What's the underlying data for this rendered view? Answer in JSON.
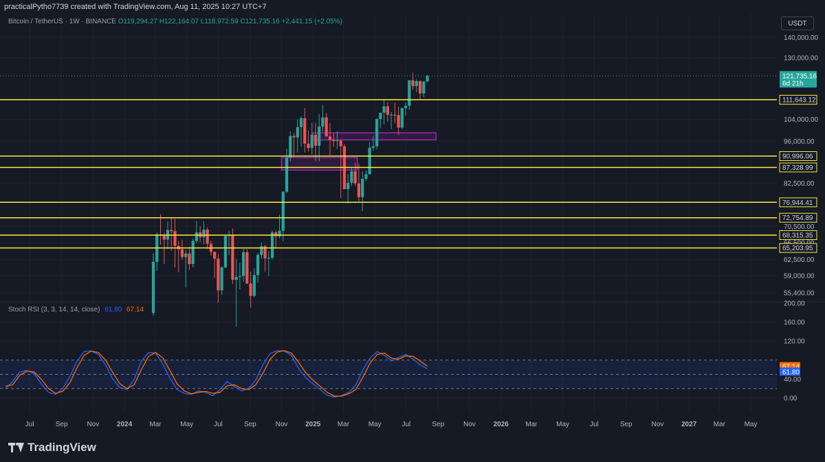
{
  "header": {
    "caption": "practicalPytho7739 created with TradingView.com, Aug 11, 2025 10:27 UTC+7"
  },
  "legend": {
    "symbol": "Bitcoin / TetherUS · 1W · BINANCE",
    "o": "O119,294.27",
    "h": "H122,164.07",
    "l": "L118,972.59",
    "c": "C121,735.16",
    "change": "+2,441.15 (+2.05%)"
  },
  "currency_button": "USDT",
  "stoch_legend": {
    "name": "Stoch RSI (3, 3, 14, 14, close)",
    "k_value": "61.80",
    "d_value": "67.14"
  },
  "footer": {
    "brand": "TradingView"
  },
  "colors": {
    "background": "#161a25",
    "bull": "#26a69a",
    "bear": "#ef5350",
    "level_line": "#ffeb3b",
    "zone": "#9c27b0",
    "k_line": "#2962ff",
    "d_line": "#ff6d00",
    "grid": "#1e2230",
    "axis_text": "#b2b5be"
  },
  "chart_data": [
    {
      "type": "candlestick",
      "title": "Bitcoin / TetherUS · 1W · BINANCE",
      "y_axis_ticks": [
        "140,000.00",
        "130,000.00",
        "104,000.00",
        "96,000.00",
        "82,500.00",
        "70,500.00",
        "66,500.00",
        "62,500.00",
        "59,000.00",
        "55,400.00"
      ],
      "y_scale": "log",
      "current_price": {
        "value": 121735.16,
        "label": "121,735.16",
        "countdown": "6d 21h"
      },
      "x_axis_ticks": [
        "Jul",
        "Sep",
        "Nov",
        "2024",
        "Mar",
        "May",
        "Jul",
        "Sep",
        "Nov",
        "2025",
        "Mar",
        "May",
        "Jul",
        "Sep",
        "Nov",
        "2026",
        "Mar",
        "May",
        "Jul",
        "Sep",
        "Nov",
        "2027",
        "Mar",
        "May"
      ],
      "horizontal_levels": [
        {
          "value": 111643.12,
          "label": "111,643.12"
        },
        {
          "value": 90996.06,
          "label": "90,996.06"
        },
        {
          "value": 87328.99,
          "label": "87,328.99"
        },
        {
          "value": 76944.41,
          "label": "76,944.41"
        },
        {
          "value": 72754.89,
          "label": "72,754.89"
        },
        {
          "value": 68315.35,
          "label": "68,315.35"
        },
        {
          "value": 65203.95,
          "label": "65,203.95"
        }
      ],
      "zones": [
        {
          "from": "2024-11",
          "to": "2025-03",
          "low": 86500,
          "high": 90500
        },
        {
          "from": "2025-01",
          "to": "2025-08",
          "low": 96500,
          "high": 99000
        }
      ],
      "candles": [
        {
          "date": "2024-02-26",
          "o": 51500,
          "h": 64000,
          "l": 51000,
          "c": 62000
        },
        {
          "date": "2024-03-04",
          "o": 62000,
          "h": 69000,
          "l": 60000,
          "c": 68500
        },
        {
          "date": "2024-03-11",
          "o": 68500,
          "h": 73700,
          "l": 66000,
          "c": 68400
        },
        {
          "date": "2024-03-18",
          "o": 68400,
          "h": 68900,
          "l": 61500,
          "c": 67200
        },
        {
          "date": "2024-03-25",
          "o": 67200,
          "h": 71800,
          "l": 65000,
          "c": 69600
        },
        {
          "date": "2024-04-01",
          "o": 69600,
          "h": 72800,
          "l": 64500,
          "c": 69300
        },
        {
          "date": "2024-04-08",
          "o": 69300,
          "h": 72500,
          "l": 60700,
          "c": 65700
        },
        {
          "date": "2024-04-15",
          "o": 65700,
          "h": 66900,
          "l": 59700,
          "c": 64900
        },
        {
          "date": "2024-04-22",
          "o": 64900,
          "h": 67200,
          "l": 62400,
          "c": 63100
        },
        {
          "date": "2024-04-29",
          "o": 63100,
          "h": 64700,
          "l": 56500,
          "c": 63900
        },
        {
          "date": "2024-05-06",
          "o": 63900,
          "h": 65500,
          "l": 60200,
          "c": 61500
        },
        {
          "date": "2024-05-13",
          "o": 61500,
          "h": 67500,
          "l": 60800,
          "c": 66900
        },
        {
          "date": "2024-05-20",
          "o": 66900,
          "h": 71900,
          "l": 66300,
          "c": 69000
        },
        {
          "date": "2024-05-27",
          "o": 69000,
          "h": 70600,
          "l": 66600,
          "c": 67800
        },
        {
          "date": "2024-06-03",
          "o": 67800,
          "h": 71900,
          "l": 66100,
          "c": 69700
        },
        {
          "date": "2024-06-10",
          "o": 69700,
          "h": 70200,
          "l": 65000,
          "c": 66200
        },
        {
          "date": "2024-06-17",
          "o": 66200,
          "h": 66900,
          "l": 63400,
          "c": 64300
        },
        {
          "date": "2024-06-24",
          "o": 64300,
          "h": 64400,
          "l": 58500,
          "c": 62700
        },
        {
          "date": "2024-07-01",
          "o": 62700,
          "h": 63800,
          "l": 53500,
          "c": 55900
        },
        {
          "date": "2024-07-08",
          "o": 55900,
          "h": 61000,
          "l": 55000,
          "c": 60800
        },
        {
          "date": "2024-07-15",
          "o": 60800,
          "h": 68300,
          "l": 60600,
          "c": 68100
        },
        {
          "date": "2024-07-22",
          "o": 68100,
          "h": 69400,
          "l": 63500,
          "c": 68300
        },
        {
          "date": "2024-07-29",
          "o": 68300,
          "h": 70000,
          "l": 57200,
          "c": 58100
        },
        {
          "date": "2024-08-05",
          "o": 58100,
          "h": 62700,
          "l": 49000,
          "c": 58700
        },
        {
          "date": "2024-08-12",
          "o": 58700,
          "h": 61800,
          "l": 56100,
          "c": 58900
        },
        {
          "date": "2024-08-19",
          "o": 58900,
          "h": 65000,
          "l": 57700,
          "c": 64200
        },
        {
          "date": "2024-08-26",
          "o": 64200,
          "h": 64900,
          "l": 57200,
          "c": 57300
        },
        {
          "date": "2024-09-02",
          "o": 57300,
          "h": 59800,
          "l": 52500,
          "c": 54800
        },
        {
          "date": "2024-09-09",
          "o": 54800,
          "h": 60600,
          "l": 54500,
          "c": 59100
        },
        {
          "date": "2024-09-16",
          "o": 59100,
          "h": 64100,
          "l": 57500,
          "c": 63600
        },
        {
          "date": "2024-09-23",
          "o": 63600,
          "h": 66500,
          "l": 62700,
          "c": 65600
        },
        {
          "date": "2024-09-30",
          "o": 65600,
          "h": 66000,
          "l": 59800,
          "c": 62800
        },
        {
          "date": "2024-10-07",
          "o": 62800,
          "h": 64400,
          "l": 58900,
          "c": 62900
        },
        {
          "date": "2024-10-14",
          "o": 62900,
          "h": 69400,
          "l": 62500,
          "c": 69000
        },
        {
          "date": "2024-10-21",
          "o": 69000,
          "h": 69500,
          "l": 65000,
          "c": 68000
        },
        {
          "date": "2024-10-28",
          "o": 68000,
          "h": 73600,
          "l": 67500,
          "c": 69400
        },
        {
          "date": "2024-11-04",
          "o": 69400,
          "h": 80000,
          "l": 66800,
          "c": 80000
        },
        {
          "date": "2024-11-11",
          "o": 80000,
          "h": 93400,
          "l": 79500,
          "c": 90500
        },
        {
          "date": "2024-11-18",
          "o": 90500,
          "h": 99600,
          "l": 89300,
          "c": 97900
        },
        {
          "date": "2024-11-25",
          "o": 97900,
          "h": 98900,
          "l": 90700,
          "c": 97400
        },
        {
          "date": "2024-12-02",
          "o": 97400,
          "h": 104000,
          "l": 92200,
          "c": 101100
        },
        {
          "date": "2024-12-09",
          "o": 101100,
          "h": 105200,
          "l": 94200,
          "c": 104400
        },
        {
          "date": "2024-12-16",
          "o": 104400,
          "h": 108300,
          "l": 92200,
          "c": 95200
        },
        {
          "date": "2024-12-23",
          "o": 95200,
          "h": 99900,
          "l": 92500,
          "c": 93700
        },
        {
          "date": "2024-12-30",
          "o": 93700,
          "h": 102700,
          "l": 91500,
          "c": 98300
        },
        {
          "date": "2025-01-06",
          "o": 98300,
          "h": 102700,
          "l": 89300,
          "c": 94500
        },
        {
          "date": "2025-01-13",
          "o": 94500,
          "h": 106000,
          "l": 89300,
          "c": 101300
        },
        {
          "date": "2025-01-20",
          "o": 101300,
          "h": 109600,
          "l": 99500,
          "c": 104700
        },
        {
          "date": "2025-01-27",
          "o": 104700,
          "h": 106400,
          "l": 97800,
          "c": 97700
        },
        {
          "date": "2025-02-03",
          "o": 97700,
          "h": 102500,
          "l": 91200,
          "c": 96500
        },
        {
          "date": "2025-02-10",
          "o": 96500,
          "h": 98800,
          "l": 94100,
          "c": 96100
        },
        {
          "date": "2025-02-17",
          "o": 96100,
          "h": 99500,
          "l": 93400,
          "c": 96300
        },
        {
          "date": "2025-02-24",
          "o": 96300,
          "h": 96500,
          "l": 78200,
          "c": 94300
        },
        {
          "date": "2025-03-03",
          "o": 94300,
          "h": 95000,
          "l": 81500,
          "c": 80700
        },
        {
          "date": "2025-03-10",
          "o": 80700,
          "h": 85300,
          "l": 76600,
          "c": 82600
        },
        {
          "date": "2025-03-17",
          "o": 82600,
          "h": 87500,
          "l": 81700,
          "c": 86100
        },
        {
          "date": "2025-03-24",
          "o": 86100,
          "h": 88800,
          "l": 81600,
          "c": 82400
        },
        {
          "date": "2025-03-31",
          "o": 82400,
          "h": 88500,
          "l": 77200,
          "c": 78400
        },
        {
          "date": "2025-04-07",
          "o": 78400,
          "h": 86100,
          "l": 74500,
          "c": 83800
        },
        {
          "date": "2025-04-14",
          "o": 83800,
          "h": 86400,
          "l": 83100,
          "c": 85200
        },
        {
          "date": "2025-04-21",
          "o": 85200,
          "h": 95700,
          "l": 85100,
          "c": 93800
        },
        {
          "date": "2025-04-28",
          "o": 93800,
          "h": 97900,
          "l": 92800,
          "c": 94300
        },
        {
          "date": "2025-05-05",
          "o": 94300,
          "h": 104300,
          "l": 93300,
          "c": 104100
        },
        {
          "date": "2025-05-12",
          "o": 104100,
          "h": 105800,
          "l": 100700,
          "c": 106500
        },
        {
          "date": "2025-05-19",
          "o": 106500,
          "h": 111900,
          "l": 102100,
          "c": 109000
        },
        {
          "date": "2025-05-26",
          "o": 109000,
          "h": 110700,
          "l": 103100,
          "c": 105700
        },
        {
          "date": "2025-06-02",
          "o": 105700,
          "h": 106800,
          "l": 100400,
          "c": 105700
        },
        {
          "date": "2025-06-09",
          "o": 105700,
          "h": 110500,
          "l": 102600,
          "c": 105600
        },
        {
          "date": "2025-06-16",
          "o": 105600,
          "h": 108900,
          "l": 98200,
          "c": 100900
        },
        {
          "date": "2025-06-23",
          "o": 100900,
          "h": 108500,
          "l": 100400,
          "c": 108300
        },
        {
          "date": "2025-06-30",
          "o": 108300,
          "h": 110500,
          "l": 105300,
          "c": 109200
        },
        {
          "date": "2025-07-07",
          "o": 109200,
          "h": 119500,
          "l": 107500,
          "c": 119800
        },
        {
          "date": "2025-07-14",
          "o": 119800,
          "h": 123200,
          "l": 115700,
          "c": 117300
        },
        {
          "date": "2025-07-21",
          "o": 117300,
          "h": 120200,
          "l": 114700,
          "c": 119400
        },
        {
          "date": "2025-07-28",
          "o": 119400,
          "h": 119800,
          "l": 111900,
          "c": 114200
        },
        {
          "date": "2025-08-04",
          "o": 114200,
          "h": 119300,
          "l": 112600,
          "c": 119300
        },
        {
          "date": "2025-08-11",
          "o": 119294.27,
          "h": 122164.07,
          "l": 118972.59,
          "c": 121735.16
        }
      ]
    },
    {
      "type": "line",
      "title": "Stoch RSI (3, 3, 14, 14, close)",
      "y_axis_ticks": [
        "200.00",
        "160.00",
        "120.00",
        "40.00",
        "0.00"
      ],
      "bands": {
        "upper": 80,
        "middle": 50,
        "lower": 20
      },
      "last_values": {
        "k": 61.8,
        "d": 67.14
      },
      "series": [
        {
          "name": "K",
          "values": [
            20,
            35,
            55,
            58,
            52,
            30,
            12,
            8,
            20,
            45,
            78,
            98,
            99,
            92,
            70,
            40,
            22,
            18,
            40,
            78,
            96,
            95,
            72,
            42,
            18,
            10,
            8,
            15,
            12,
            5,
            18,
            35,
            24,
            15,
            20,
            38,
            70,
            94,
            100,
            99,
            90,
            62,
            43,
            30,
            18,
            6,
            2,
            5,
            12,
            28,
            60,
            85,
            98,
            90,
            78,
            86,
            92,
            82,
            70,
            61.8
          ]
        },
        {
          "name": "D",
          "values": [
            25,
            28,
            48,
            57,
            55,
            40,
            20,
            10,
            14,
            32,
            64,
            90,
            99,
            96,
            80,
            54,
            30,
            20,
            28,
            60,
            88,
            96,
            85,
            58,
            30,
            15,
            9,
            12,
            14,
            10,
            12,
            26,
            28,
            20,
            18,
            28,
            52,
            82,
            97,
            100,
            95,
            75,
            53,
            38,
            25,
            12,
            4,
            4,
            9,
            18,
            44,
            74,
            92,
            95,
            84,
            82,
            89,
            88,
            78,
            67.14
          ]
        }
      ],
      "x_axis_ticks": [
        "Jul",
        "Sep",
        "Nov",
        "2024",
        "Mar",
        "May",
        "Jul",
        "Sep",
        "Nov",
        "2025",
        "Mar",
        "May",
        "Jul",
        "Sep",
        "Nov",
        "2026",
        "Mar",
        "May",
        "Jul",
        "Sep",
        "Nov",
        "2027",
        "Mar",
        "May"
      ]
    }
  ]
}
